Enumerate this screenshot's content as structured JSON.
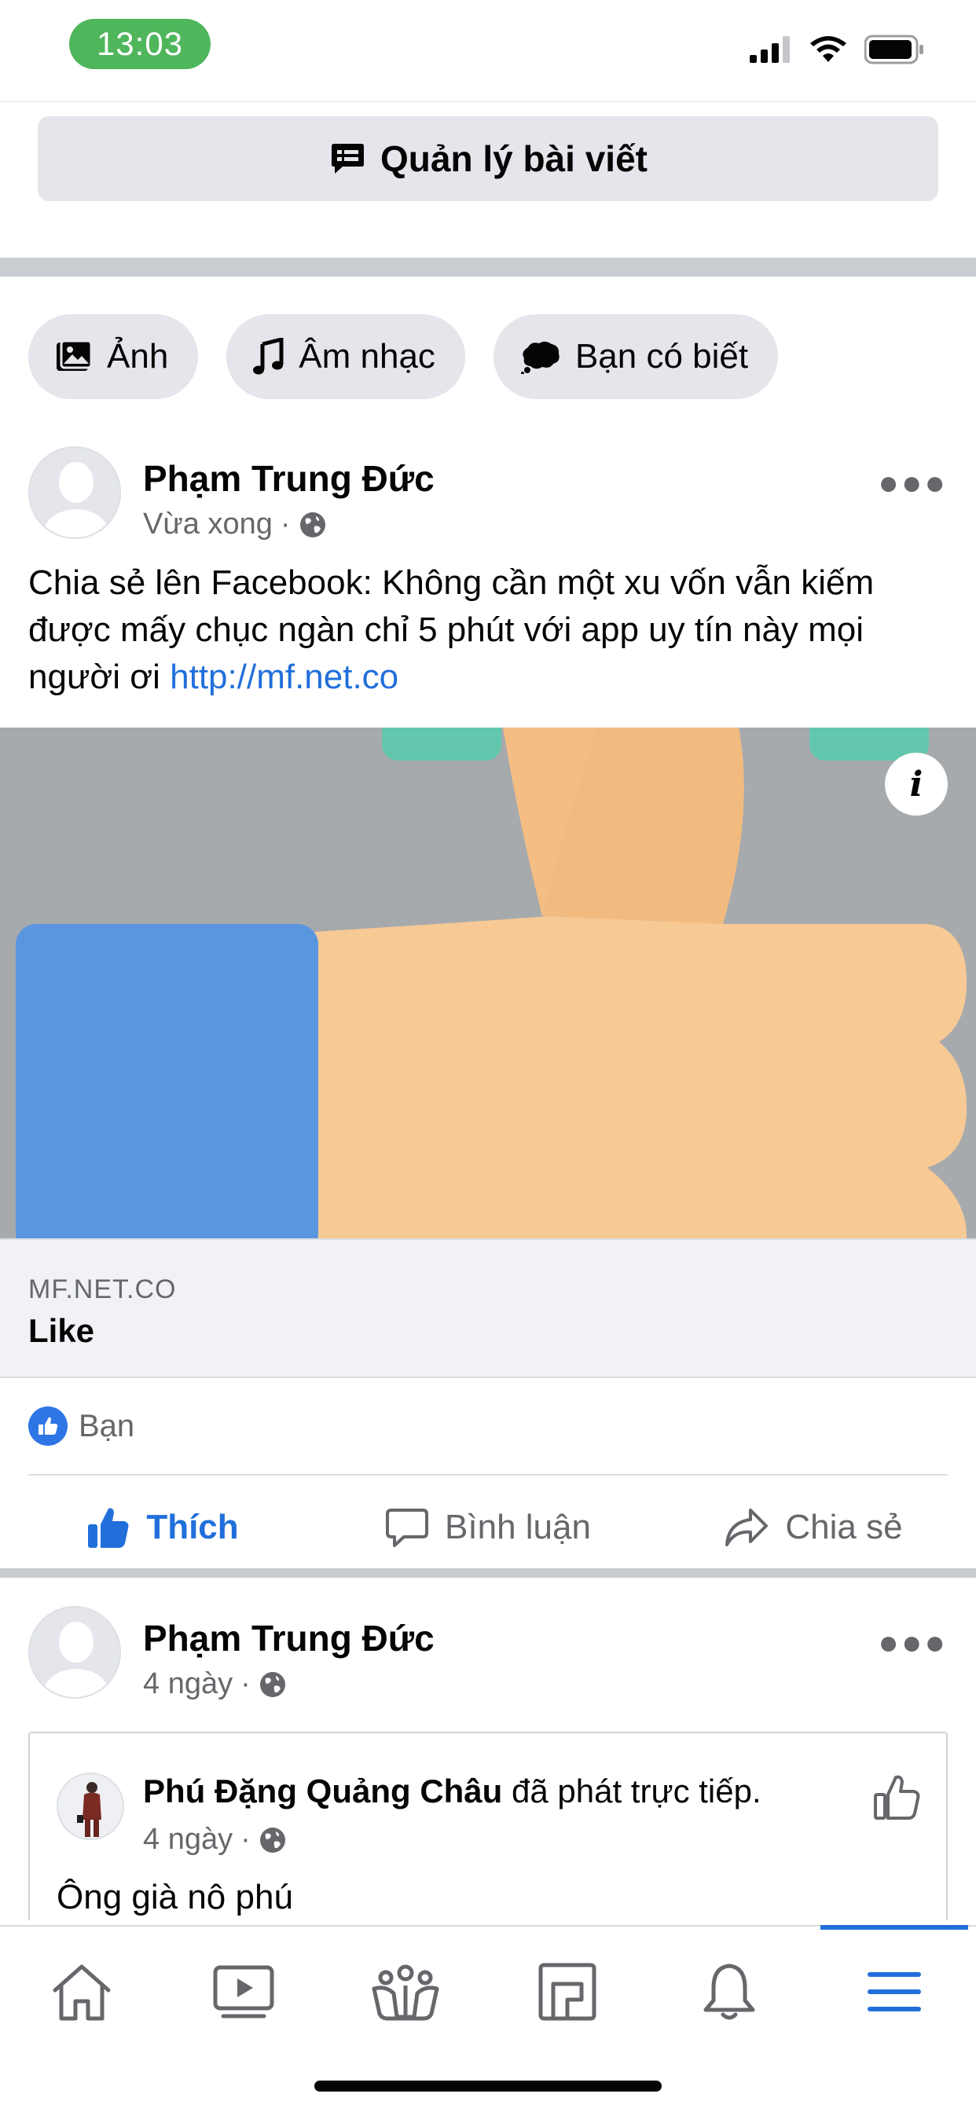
{
  "status_bar": {
    "time": "13:03"
  },
  "manage_posts": {
    "label": "Quản lý bài viết"
  },
  "chips": [
    {
      "label": "Ảnh",
      "icon": "photo-icon"
    },
    {
      "label": "Âm nhạc",
      "icon": "music-note-icon"
    },
    {
      "label": "Bạn có biết",
      "icon": "speech-bubble-icon"
    }
  ],
  "post1": {
    "author": "Phạm Trung Đức",
    "time": "Vừa xong",
    "text_main": "Chia sẻ lên Facebook: Không cần một xu vốn vẫn kiếm được mấy chục ngàn chỉ 5 phút với app uy tín này mọi người ơi",
    "text_link": "http://mf.net.co",
    "link_domain": "MF.NET.CO",
    "link_title": "Like",
    "reactions_label": "Bạn",
    "actions": {
      "like": "Thích",
      "comment": "Bình luận",
      "share": "Chia sẻ"
    }
  },
  "post2": {
    "author": "Phạm Trung Đức",
    "time": "4 ngày",
    "shared": {
      "author": "Phú Đặng Quảng Châu",
      "action": "đã phát trực tiếp.",
      "time": "4 ngày",
      "text": "Ông già nô phú"
    }
  },
  "colors": {
    "facebook_blue": "#216fdb",
    "status_green": "#4fb65b",
    "chip_gray": "#e4e6eb",
    "image_gray": "#a7aaad",
    "thumb_skin": "#f6c995",
    "cuff_blue": "#5a96e0",
    "teal": "#63c7ad"
  },
  "tab_bar": {
    "tabs": [
      "home-icon",
      "video-icon",
      "groups-icon",
      "marketplace-icon",
      "bell-icon",
      "menu-icon"
    ],
    "active_tab": "menu-icon"
  }
}
